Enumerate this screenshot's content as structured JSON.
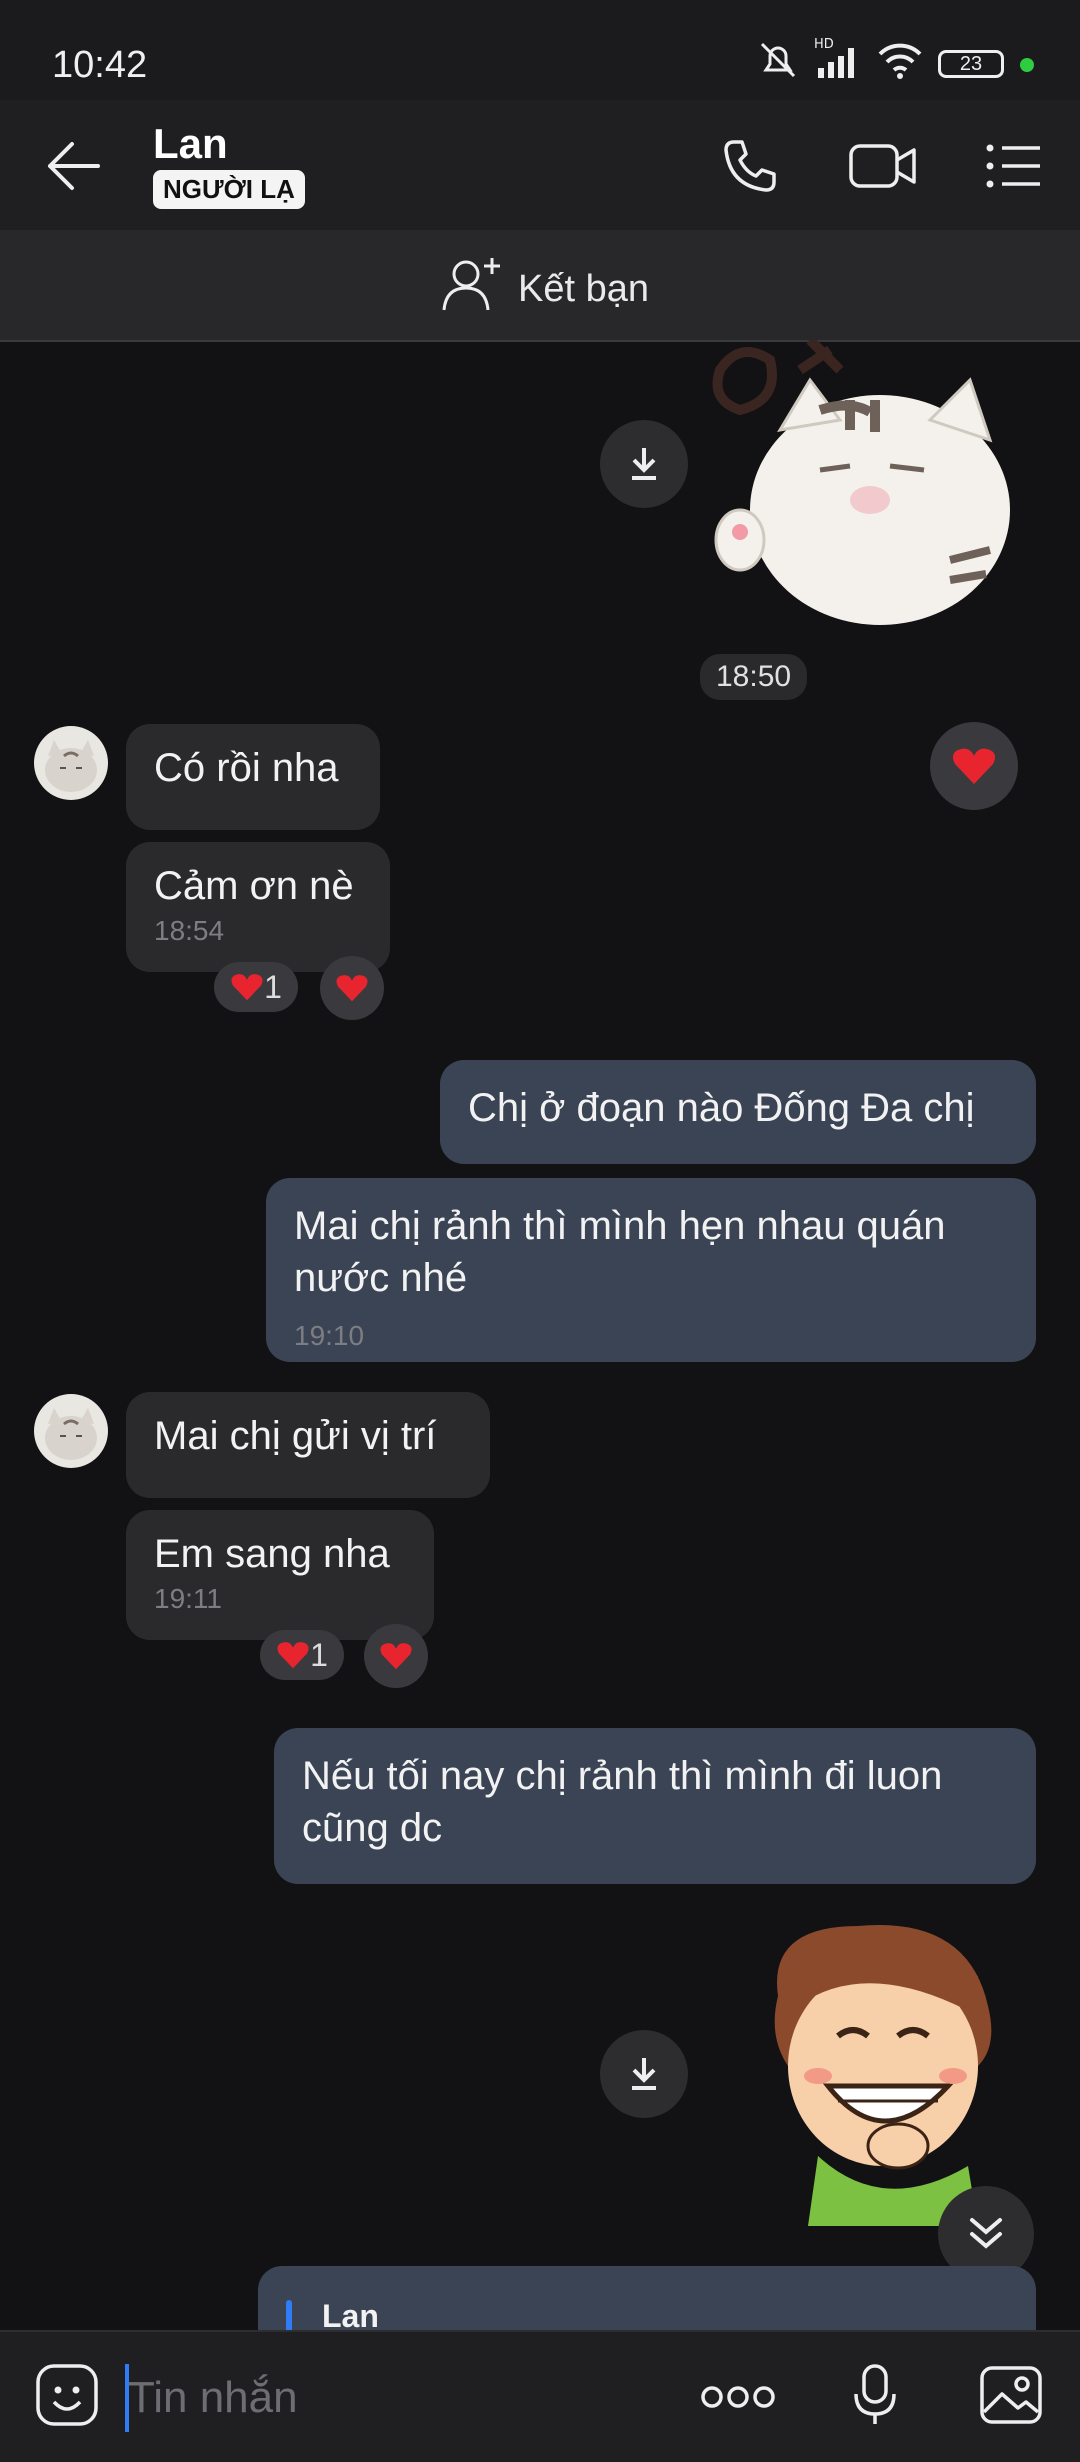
{
  "status_bar": {
    "time": "10:42",
    "battery": "23",
    "network_badge": "HD"
  },
  "header": {
    "title": "Lan",
    "badge": "NGƯỜI LẠ"
  },
  "friend_bar": {
    "label": "Kết bạn"
  },
  "messages": {
    "sticker_time": "18:50",
    "in1_text": "Có rồi nha",
    "in2_text": "Cảm ơn nè",
    "in2_time": "18:54",
    "react1_count": "1",
    "out1_text": "Chị ở đoạn nào Đống Đa chị",
    "out2_text": "Mai chị rảnh thì mình hẹn nhau quán nước nhé",
    "out2_time": "19:10",
    "in3_text": "Mai chị gửi vị trí",
    "in4_text": "Em sang nha",
    "in4_time": "19:11",
    "react2_count": "1",
    "out3_text": "Nếu tối nay chị rảnh thì mình đi luon cũng dc",
    "reply_name": "Lan"
  },
  "composer": {
    "placeholder": "Tin nhắn"
  },
  "colors": {
    "background": "#121214",
    "incoming_bubble": "#2a2a2d",
    "outgoing_bubble": "#3b4455",
    "accent": "#2f7cf6",
    "heart": "#e8252f"
  }
}
